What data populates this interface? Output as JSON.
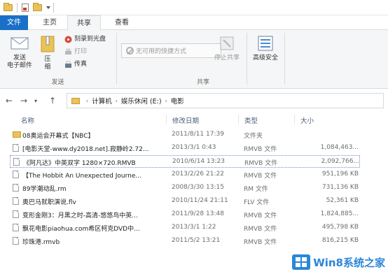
{
  "ribbon_tabs": {
    "file": "文件",
    "home": "主页",
    "share": "共享",
    "view": "查看"
  },
  "ribbon": {
    "send_email": "发送\n电子邮件",
    "compress": "压\n缩",
    "burn": "刻录到光盘",
    "print": "打印",
    "fax": "传真",
    "shortcut_dropdown": "无可用的快捷方式",
    "stop_sharing": "停止共享",
    "advanced_security": "高级安全",
    "group_send": "发送",
    "group_share_with": "共享"
  },
  "address": {
    "crumbs": [
      "计算机",
      "娱乐休闲 (E:)",
      "电影"
    ]
  },
  "columns": {
    "name": "名称",
    "date": "修改日期",
    "type": "类型",
    "size": "大小"
  },
  "files": [
    {
      "name": "08奥运会开幕式【NBC】",
      "date": "2011/8/11 17:39",
      "type": "文件夹",
      "size": "",
      "kind": "folder"
    },
    {
      "name": "[电影天堂-www.dy2018.net].寂静岭2.72...",
      "date": "2013/3/1 0:43",
      "type": "RMVB 文件",
      "size": "1,084,463...",
      "kind": "file"
    },
    {
      "name": "《阿凡达》中英双字 1280×720.RMVB",
      "date": "2010/6/14 13:23",
      "type": "RMVB 文件",
      "size": "2,092,766...",
      "kind": "file",
      "selected": true
    },
    {
      "name": "【The Hobbit An Unexpected Journe...",
      "date": "2013/2/26 21:22",
      "type": "RMVB 文件",
      "size": "951,196 KB",
      "kind": "file"
    },
    {
      "name": "89学潮动乱.rm",
      "date": "2008/3/30 13:15",
      "type": "RM 文件",
      "size": "731,136 KB",
      "kind": "file"
    },
    {
      "name": "奥巴马就职演说.flv",
      "date": "2010/11/24 21:11",
      "type": "FLV 文件",
      "size": "52,361 KB",
      "kind": "file"
    },
    {
      "name": "变形金刚3：月黑之时-高清-悠悠鸟中英...",
      "date": "2011/9/28 13:48",
      "type": "RMVB 文件",
      "size": "1,824,885...",
      "kind": "file"
    },
    {
      "name": "飘花电影piaohua.com希区柯克DVD中...",
      "date": "2013/3/1 1:22",
      "type": "RMVB 文件",
      "size": "495,798 KB",
      "kind": "file"
    },
    {
      "name": "珍珠港.rmvb",
      "date": "2011/5/2 13:21",
      "type": "RMVB 文件",
      "size": "816,215 KB",
      "kind": "file"
    }
  ],
  "watermark": "Win8系统之家",
  "colors": {
    "file_tab": "#1a6fc9",
    "folder": "#e9c35a",
    "watermark": "#2a86d8"
  }
}
